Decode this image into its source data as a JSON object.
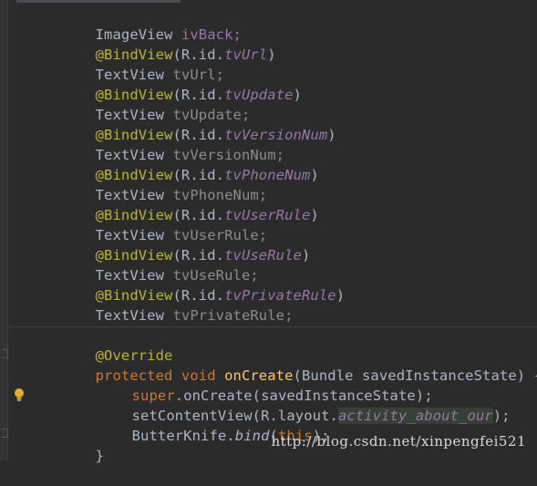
{
  "code_lines": [
    {
      "id": "l1",
      "parts": [
        "ImageView ",
        "ivBack;"
      ]
    },
    {
      "id": "l2",
      "parts": [
        "@BindView",
        "(R.id.",
        "tvUrl",
        ")"
      ]
    },
    {
      "id": "l3",
      "parts": [
        "TextView ",
        "tvUrl;"
      ]
    },
    {
      "id": "l4",
      "parts": [
        "@BindView",
        "(R.id.",
        "tvUpdate",
        ")"
      ]
    },
    {
      "id": "l5",
      "parts": [
        "TextView ",
        "tvUpdate;"
      ]
    },
    {
      "id": "l6",
      "parts": [
        "@BindView",
        "(R.id.",
        "tvVersionNum",
        ")"
      ]
    },
    {
      "id": "l7",
      "parts": [
        "TextView ",
        "tvVersionNum;"
      ]
    },
    {
      "id": "l8",
      "parts": [
        "@BindView",
        "(R.id.",
        "tvPhoneNum",
        ")"
      ]
    },
    {
      "id": "l9",
      "parts": [
        "TextView ",
        "tvPhoneNum;"
      ]
    },
    {
      "id": "l10",
      "parts": [
        "@BindView",
        "(R.id.",
        "tvUserRule",
        ")"
      ]
    },
    {
      "id": "l11",
      "parts": [
        "TextView ",
        "tvUserRule;"
      ]
    },
    {
      "id": "l12",
      "parts": [
        "@BindView",
        "(R.id.",
        "tvUseRule",
        ")"
      ]
    },
    {
      "id": "l13",
      "parts": [
        "TextView ",
        "tvUseRule;"
      ]
    },
    {
      "id": "l14",
      "parts": [
        "@BindView",
        "(R.id.",
        "tvPrivateRule",
        ")"
      ]
    },
    {
      "id": "l15",
      "parts": [
        "TextView ",
        "tvPrivateRule;"
      ]
    }
  ],
  "method": {
    "annotation": "@Override",
    "signature_kw": "protected void ",
    "signature_name": "onCreate",
    "signature_rest": "(Bundle savedInstanceState) {",
    "body": {
      "super_kw": "super",
      "super_rest": ".onCreate(savedInstanceState);",
      "set_call": "setContentView(R.layout.",
      "set_field": "activity_about_our",
      "set_end": ");",
      "bk_obj": "ButterKnife.",
      "bk_method": "bind",
      "bk_open": "(",
      "bk_this": "this",
      "bk_end": ");"
    },
    "close": "}"
  },
  "watermark": "http://blog.csdn.net/xinpengfei521"
}
